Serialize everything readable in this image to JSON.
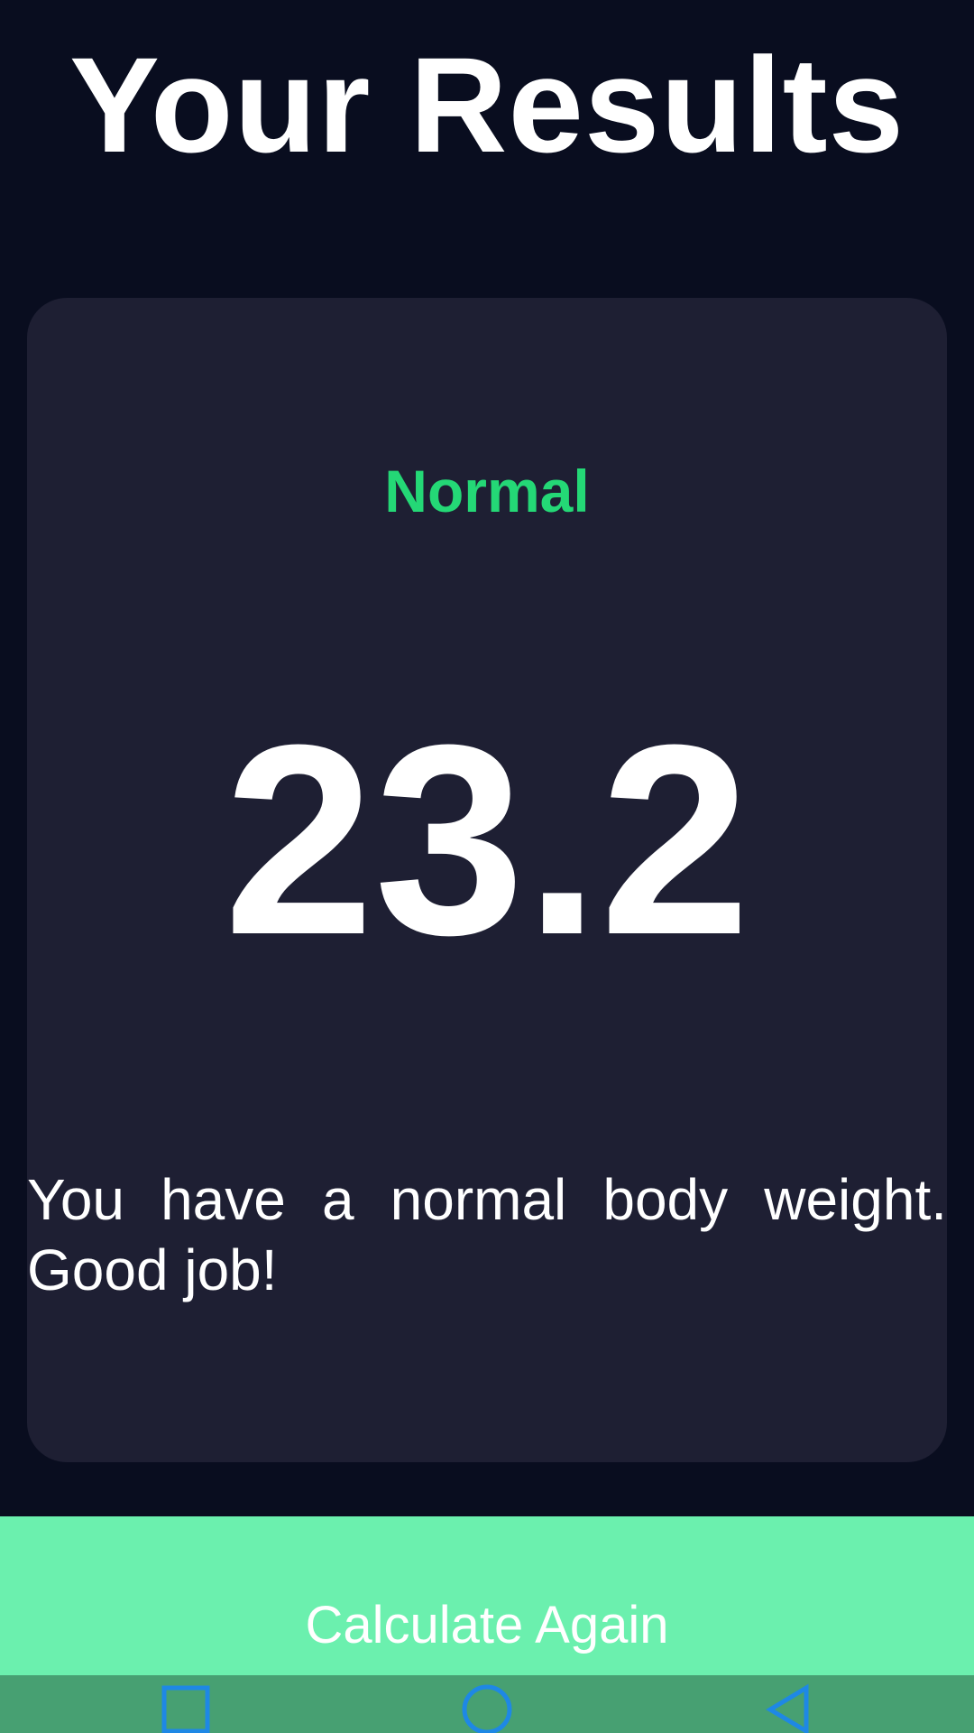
{
  "header": {
    "title": "Your Results"
  },
  "result": {
    "status": "Normal",
    "bmi": "23.2",
    "message": "You have a normal body weight. Good job!"
  },
  "actions": {
    "recalculate_label": "Calculate Again"
  },
  "nav_bar": {
    "icons": [
      "recent-apps-icon",
      "home-icon",
      "back-icon"
    ]
  },
  "colors": {
    "background": "#090d1f",
    "card": "#1e1f33",
    "status_normal": "#24d876",
    "button": "#6bf0ae",
    "nav_bar": "#47a072",
    "nav_icon": "#1e88e5"
  }
}
